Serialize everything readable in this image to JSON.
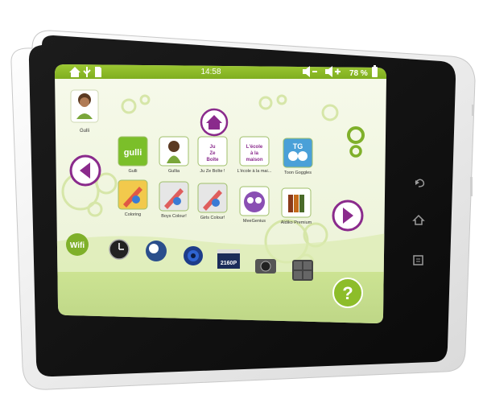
{
  "status_bar": {
    "time": "14:58",
    "battery": "78 %",
    "left_icons": [
      "home-icon",
      "usb-icon",
      "sd-card-icon"
    ],
    "right_icons": [
      "volume-down-icon",
      "volume-up-icon",
      "battery-icon"
    ]
  },
  "profile": {
    "name": "Gulli"
  },
  "apps": [
    {
      "label": "Gulli",
      "icon": "gulli-icon",
      "logo": "gulli"
    },
    {
      "label": "Gullia",
      "icon": "character-icon"
    },
    {
      "label": "Ju Ze Boîte !",
      "icon": "box-icon",
      "logo_lines": [
        "Ju",
        "Ze",
        "Boîte"
      ]
    },
    {
      "label": "L'école à la mai...",
      "icon": "school-icon",
      "logo_lines": [
        "L'école",
        "à la",
        "maison"
      ]
    },
    {
      "label": "Toon Goggles",
      "icon": "toon-goggles-icon",
      "logo": "TG"
    },
    {
      "label": "Coloring",
      "icon": "coloring-icon"
    },
    {
      "label": "Boys Colour!",
      "icon": "boys-colour-icon"
    },
    {
      "label": "Girls Colour!",
      "icon": "girls-colour-icon"
    },
    {
      "label": "MeeGenius",
      "icon": "owl-icon"
    },
    {
      "label": "Aldiko Premium",
      "icon": "books-icon"
    }
  ],
  "dock": [
    {
      "label": "Wifi",
      "icon": "wifi-icon"
    },
    {
      "icon": "clock-icon"
    },
    {
      "icon": "gallery-icon"
    },
    {
      "icon": "speaker-icon"
    },
    {
      "label": "2160P",
      "icon": "video-icon"
    },
    {
      "icon": "camera-icon"
    },
    {
      "icon": "calculator-icon"
    },
    {
      "label": "?",
      "icon": "help-icon"
    }
  ],
  "nav": {
    "home": "home-icon",
    "prev": "left-arrow-icon",
    "next": "right-arrow-icon",
    "logo": "gulli-g-logo"
  },
  "hardware_buttons": [
    "back-icon",
    "home-key-icon",
    "menu-icon"
  ],
  "colors": {
    "screen_bg": "#f4f8e6",
    "status_green": "#8dbd2a",
    "accent_purple": "#8a2a8c",
    "bezel_black": "#141414",
    "frame_white": "#f2f2f2"
  }
}
